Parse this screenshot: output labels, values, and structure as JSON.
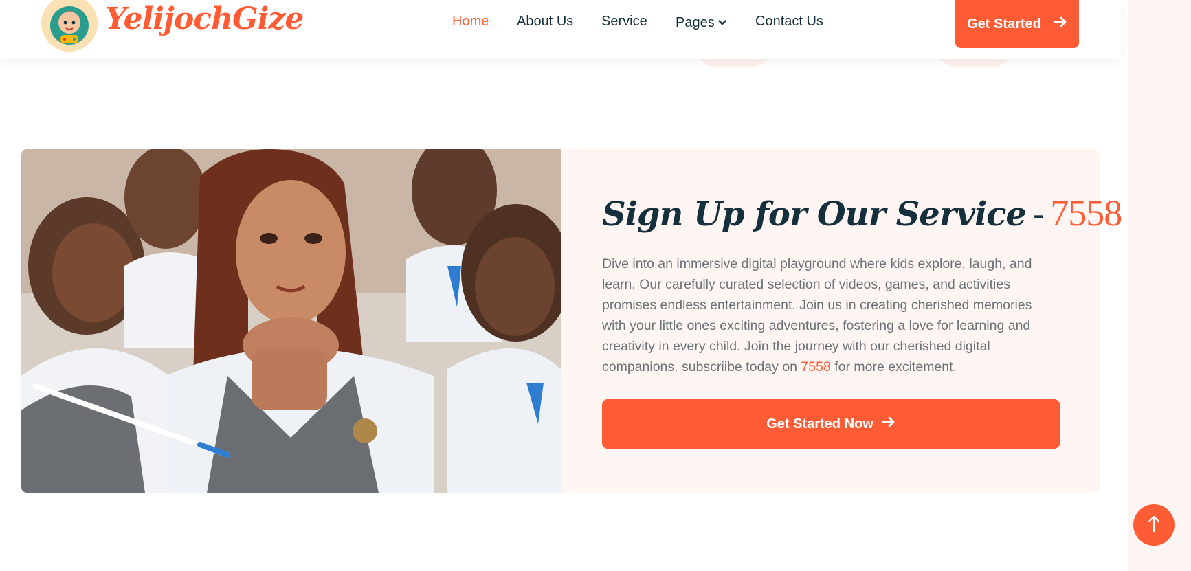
{
  "header": {
    "brand": "YelijochGize",
    "nav": [
      {
        "label": "Home",
        "active": true
      },
      {
        "label": "About Us",
        "active": false
      },
      {
        "label": "Service",
        "active": false
      },
      {
        "label": "Pages",
        "active": false,
        "has_dropdown": true
      },
      {
        "label": "Contact Us",
        "active": false
      }
    ],
    "cta_label": "Get Started",
    "cta_icon": "arrow-right-icon"
  },
  "signup": {
    "title": "Sign Up for Our Service",
    "title_separator": "-",
    "title_number": "7558",
    "desc_main": "Dive into an immersive digital playground where kids explore, laugh, and learn. Our carefully curated selection of videos, games, and activities promises endless entertainment. Join us in creating cherished memories with your little ones exciting adventures, fostering a love for learning and creativity in every child. Join the journey with our cherished digital companions. subscriibe today on ",
    "desc_number": "7558",
    "desc_tail": " for more excitement.",
    "button_label": "Get Started Now",
    "button_icon": "arrow-right-icon",
    "image_icon": "students-photo"
  },
  "scroll_top_icon": "arrow-up-icon",
  "colors": {
    "accent": "#ff5c35",
    "heading": "#14303d",
    "body_text": "#6a7378",
    "card_bg": "#fff5f3"
  }
}
